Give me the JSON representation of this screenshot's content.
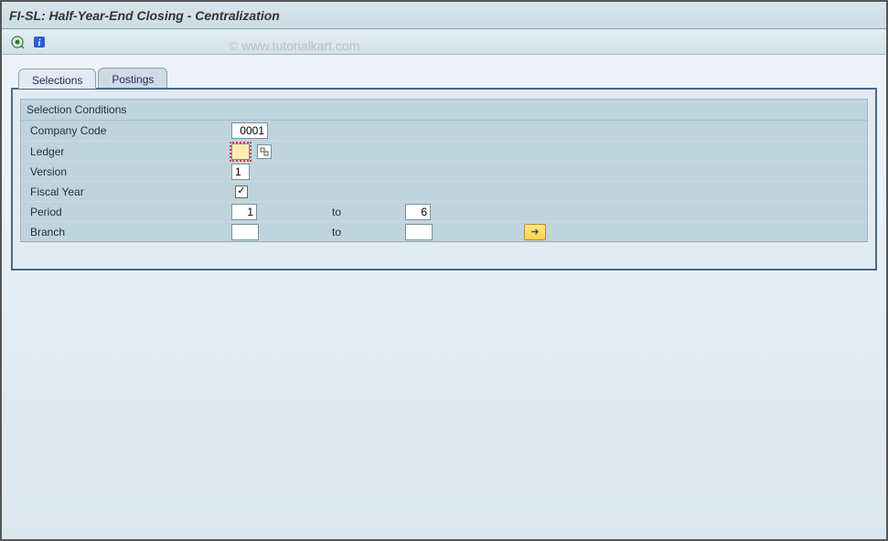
{
  "header": {
    "title": "FI-SL: Half-Year-End Closing - Centralization"
  },
  "toolbar": {
    "execute_tip": "Execute",
    "info_tip": "Information"
  },
  "watermark": "© www.tutorialkart.com",
  "tabs": [
    {
      "label": "Selections",
      "active": true
    },
    {
      "label": "Postings",
      "active": false
    }
  ],
  "groupbox": {
    "title": "Selection Conditions"
  },
  "fields": {
    "company_code": {
      "label": "Company Code",
      "value": "0001"
    },
    "ledger": {
      "label": "Ledger",
      "value": ""
    },
    "version": {
      "label": "Version",
      "value": "1"
    },
    "fiscal_year": {
      "label": "Fiscal Year",
      "checked": true
    },
    "period": {
      "label": "Period",
      "from": "1",
      "to_label": "to",
      "to": "6"
    },
    "branch": {
      "label": "Branch",
      "from": "",
      "to_label": "to",
      "to": ""
    }
  },
  "icons": {
    "arrow_right": "➜"
  }
}
